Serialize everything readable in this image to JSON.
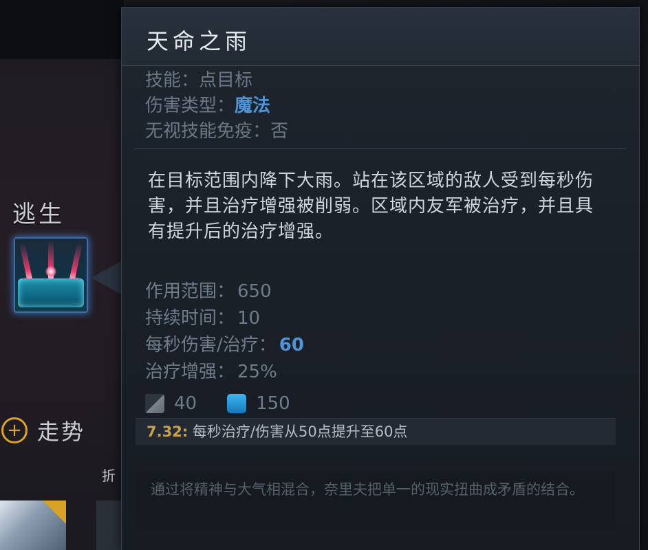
{
  "left_panel": {
    "section_title": "逃生",
    "trend_label": "走势",
    "small_text": "折",
    "trend_icon_glyph": "+"
  },
  "tooltip": {
    "title": "天命之雨",
    "info": {
      "skill_label": "技能：",
      "skill_value": "点目标",
      "damage_type_label": "伤害类型：",
      "damage_type_value": "魔法",
      "pierce_label": "无视技能免疫：",
      "pierce_value": "否"
    },
    "description": "在目标范围内降下大雨。站在该区域的敌人受到每秒伤害，并且治疗增强被削弱。区域内友军被治疗，并且具有提升后的治疗增强。",
    "stats": [
      {
        "label": "作用范围：",
        "value": "650",
        "highlight": false
      },
      {
        "label": "持续时间：",
        "value": "10",
        "highlight": false
      },
      {
        "label": "每秒伤害/治疗：",
        "value": "60",
        "highlight": true
      },
      {
        "label": "治疗增强：",
        "value": "25%",
        "highlight": false
      }
    ],
    "cooldown": "40",
    "mana_cost": "150",
    "patch_note": {
      "version": "7.32:",
      "text": "每秒治疗/伤害从50点提升至60点"
    },
    "lore": "通过将精神与大气相混合，奈里夫把单一的现实扭曲成矛盾的结合。"
  },
  "colors": {
    "highlight_blue": "#4f94d6",
    "patch_gold": "#c9a24a",
    "muted_text": "#6f7c8b",
    "trend_orange": "#e0a22a"
  }
}
